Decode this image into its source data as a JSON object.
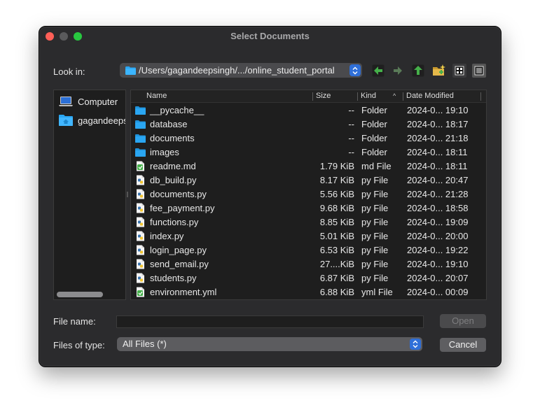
{
  "window": {
    "title": "Select Documents"
  },
  "look_in": {
    "label": "Look in:",
    "path": "/Users/gagandeepsingh/.../online_student_portal"
  },
  "toolbar": {
    "icons": [
      "back-arrow-icon",
      "forward-arrow-icon",
      "parent-folder-icon",
      "new-folder-icon",
      "icon-view-icon",
      "detail-view-icon"
    ]
  },
  "sidebar": {
    "items": [
      {
        "label": "Computer",
        "icon": "computer-icon"
      },
      {
        "label": "gagandeepsingh",
        "icon": "home-folder-icon"
      }
    ]
  },
  "file_list": {
    "columns": {
      "name": "Name",
      "size": "Size",
      "kind": "Kind",
      "date": "Date Modified"
    },
    "sort_column": "Kind",
    "sort_order": "ascending",
    "rows": [
      {
        "name": "__pycache__",
        "size": "--",
        "kind": "Folder",
        "date": "2024-0... 19:10",
        "icon": "folder"
      },
      {
        "name": "database",
        "size": "--",
        "kind": "Folder",
        "date": "2024-0... 18:17",
        "icon": "folder"
      },
      {
        "name": "documents",
        "size": "--",
        "kind": "Folder",
        "date": "2024-0... 21:18",
        "icon": "folder"
      },
      {
        "name": "images",
        "size": "--",
        "kind": "Folder",
        "date": "2024-0... 18:11",
        "icon": "folder"
      },
      {
        "name": "readme.md",
        "size": "1.79 KiB",
        "kind": "md File",
        "date": "2024-0... 18:11",
        "icon": "text"
      },
      {
        "name": "db_build.py",
        "size": "8.17 KiB",
        "kind": "py File",
        "date": "2024-0... 20:47",
        "icon": "python"
      },
      {
        "name": "documents.py",
        "size": "5.56 KiB",
        "kind": "py File",
        "date": "2024-0... 21:28",
        "icon": "python"
      },
      {
        "name": "fee_payment.py",
        "size": "9.68 KiB",
        "kind": "py File",
        "date": "2024-0... 18:58",
        "icon": "python"
      },
      {
        "name": "functions.py",
        "size": "8.85 KiB",
        "kind": "py File",
        "date": "2024-0... 19:09",
        "icon": "python"
      },
      {
        "name": "index.py",
        "size": "5.01 KiB",
        "kind": "py File",
        "date": "2024-0... 20:00",
        "icon": "python"
      },
      {
        "name": "login_page.py",
        "size": "6.53 KiB",
        "kind": "py File",
        "date": "2024-0... 19:22",
        "icon": "python"
      },
      {
        "name": "send_email.py",
        "size": "27....KiB",
        "kind": "py File",
        "date": "2024-0... 19:10",
        "icon": "python"
      },
      {
        "name": "students.py",
        "size": "6.87 KiB",
        "kind": "py File",
        "date": "2024-0... 20:07",
        "icon": "python"
      },
      {
        "name": "environment.yml",
        "size": "6.88 KiB",
        "kind": "yml File",
        "date": "2024-0... 00:09",
        "icon": "text"
      }
    ]
  },
  "file_name": {
    "label": "File name:",
    "value": ""
  },
  "files_of_type": {
    "label": "Files of type:",
    "value": "All Files (*)"
  },
  "buttons": {
    "open": "Open",
    "cancel": "Cancel"
  },
  "colors": {
    "accent": "#2f6fd8",
    "folder": "#2aa6f2",
    "toolbar_green": "#45b04a"
  }
}
